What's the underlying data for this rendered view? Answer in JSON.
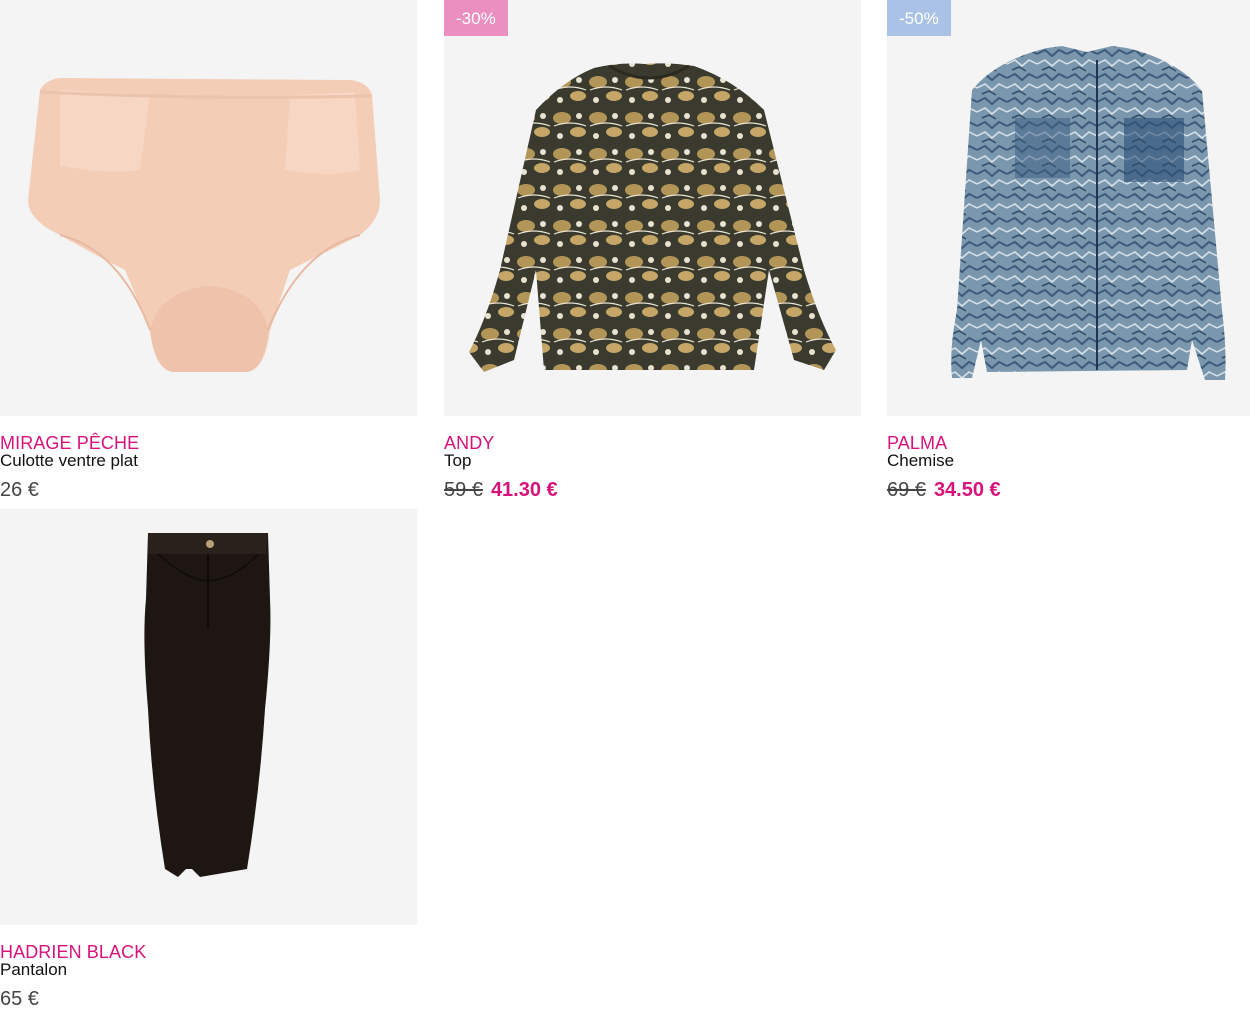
{
  "products": [
    {
      "brand": "MIRAGE PÊCHE",
      "name": "Culotte ventre plat",
      "price": "26 €",
      "image_icon": "briefs-image"
    },
    {
      "brand": "ANDY",
      "name": "Top",
      "badge": "-30%",
      "old_price": "59 €",
      "new_price": "41.30 €",
      "image_icon": "paisley-top-image"
    },
    {
      "brand": "PALMA",
      "name": "Chemise",
      "badge": "-50%",
      "old_price": "69 €",
      "new_price": "34.50 €",
      "image_icon": "sheer-shirt-image"
    },
    {
      "brand": "HADRIEN BLACK",
      "name": "Pantalon",
      "price": "65 €",
      "image_icon": "trousers-image"
    }
  ],
  "colors": {
    "accent": "#d7127a",
    "badge_pink": "#ea8fbf",
    "badge_blue": "#a9c2e6",
    "image_bg": "#f4f4f4"
  }
}
